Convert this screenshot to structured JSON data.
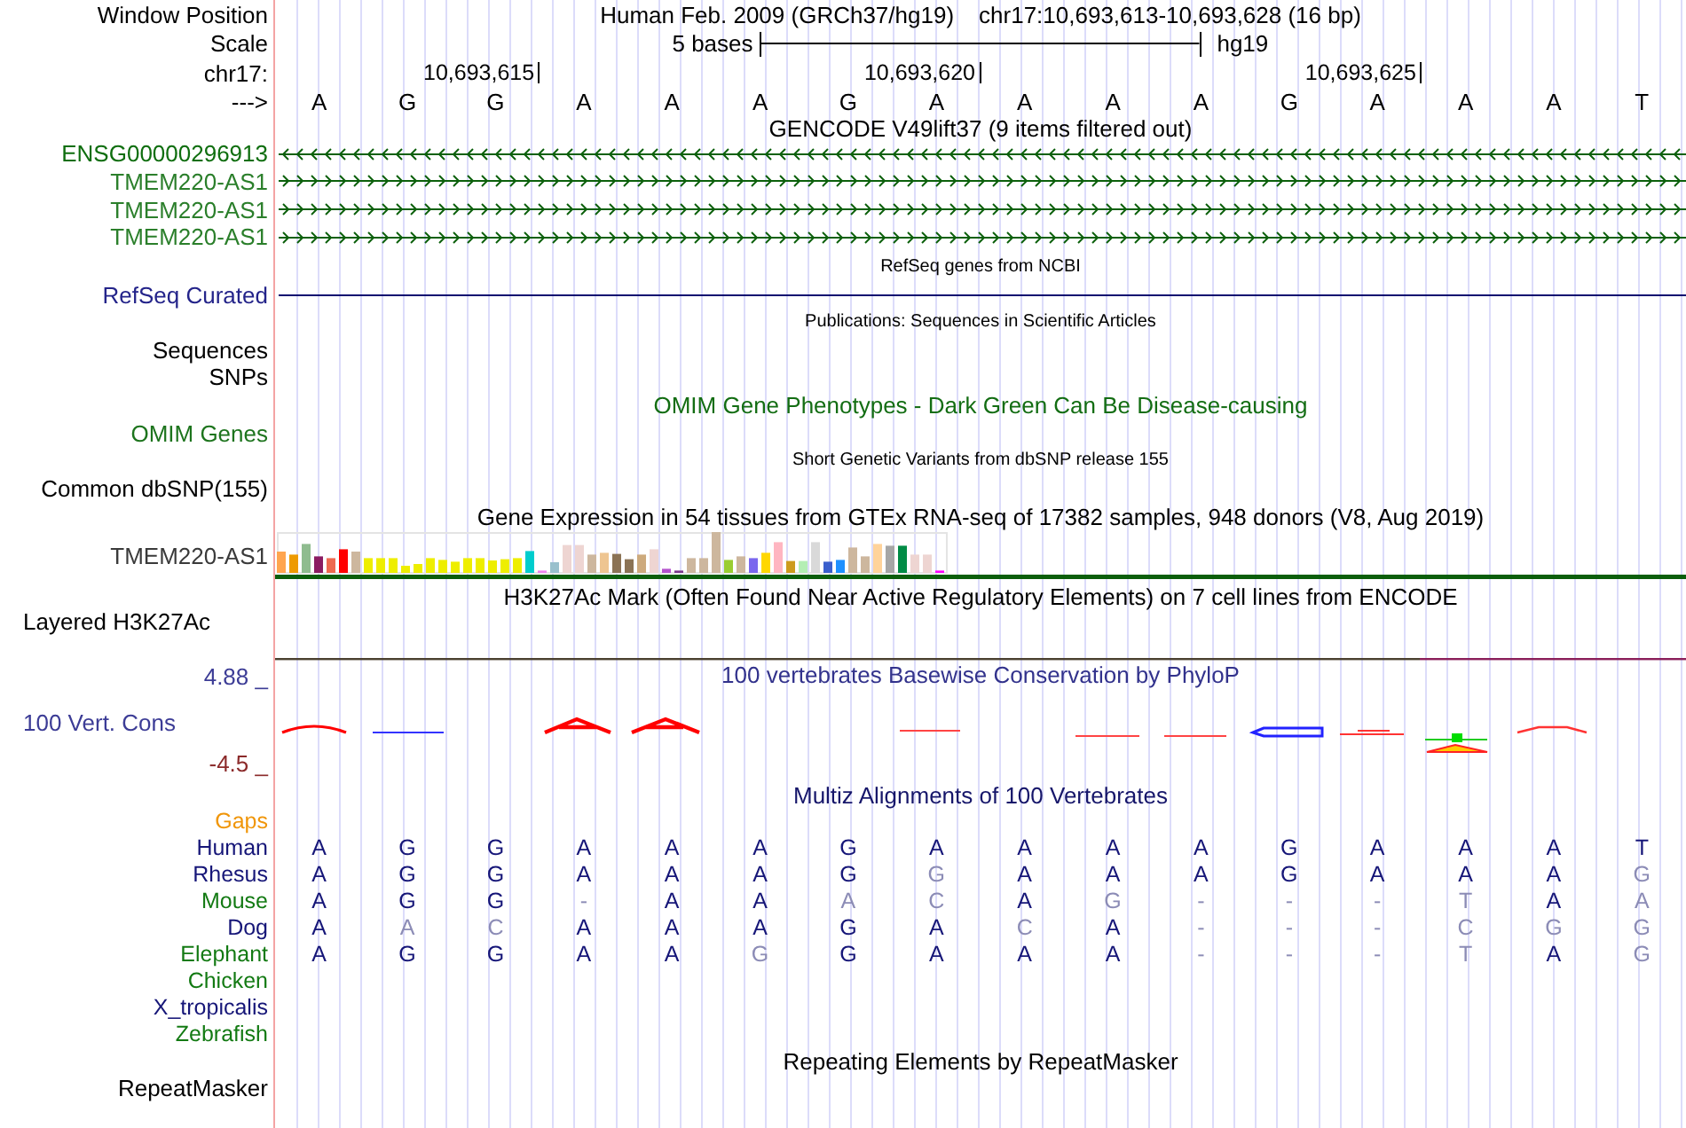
{
  "position": {
    "label": "Window Position",
    "assembly": "Human Feb. 2009 (GRCh37/hg19)",
    "range": "chr17:10,693,613-10,693,628 (16 bp)"
  },
  "scale": {
    "label": "Scale",
    "span": "5 bases",
    "assembly": "hg19"
  },
  "ruler": {
    "label": "chr17:",
    "ticks": [
      "10,693,615",
      "10,693,620",
      "10,693,625"
    ]
  },
  "sequence": {
    "label": "--->",
    "bases": [
      "A",
      "G",
      "G",
      "A",
      "A",
      "A",
      "G",
      "A",
      "A",
      "A",
      "A",
      "G",
      "A",
      "A",
      "A",
      "T"
    ]
  },
  "tracks": [
    {
      "kind": "genes",
      "title": {
        "text": "GENCODE V49lift37 (9 items filtered out)",
        "color": "#000000"
      },
      "items": [
        {
          "label": "ENSG00000296913",
          "color": "#0f6e0f",
          "minus_strand": true
        },
        {
          "label": "TMEM220-AS1",
          "color": "#2b7f2b",
          "minus_strand": false
        },
        {
          "label": "TMEM220-AS1",
          "color": "#2b7f2b",
          "minus_strand": false
        },
        {
          "label": "TMEM220-AS1",
          "color": "#2b7f2b",
          "minus_strand": false
        }
      ]
    },
    {
      "kind": "gene_line",
      "title": {
        "text": "RefSeq genes from NCBI",
        "color": "#000000"
      },
      "items": [
        {
          "label": "RefSeq Curated",
          "color": "#24248a"
        }
      ]
    },
    {
      "kind": "listing",
      "title": {
        "text": "Publications: Sequences in Scientific Articles",
        "color": "#000000"
      },
      "items": [
        {
          "label": "Sequences",
          "color": "#000000"
        },
        {
          "label": "SNPs",
          "color": "#000000"
        }
      ]
    },
    {
      "kind": "empty",
      "title": {
        "text": "OMIM Gene Phenotypes - Dark Green Can Be Disease-causing",
        "color": "#136d13"
      },
      "items": [
        {
          "label": "OMIM Genes",
          "color": "#1d741d"
        }
      ]
    },
    {
      "kind": "listing",
      "title": {
        "text": "Short Genetic Variants from dbSNP release 155",
        "color": "#000000"
      },
      "items": [
        {
          "label": "Common dbSNP(155)",
          "color": "#000000"
        }
      ]
    },
    {
      "kind": "expression",
      "title": {
        "text": "Gene Expression in 54 tissues from GTEx RNA-seq of 17382 samples, 948 donors (V8, Aug 2019)",
        "color": "#000000"
      },
      "items": [
        {
          "label": "TMEM220-AS1",
          "color": "#3a3a3a"
        }
      ]
    },
    {
      "kind": "signal",
      "title": {
        "text": "H3K27Ac Mark (Often Found Near Active Regulatory Elements) on 7 cell lines from ENCODE",
        "color": "#000000"
      },
      "items": [
        {
          "label": "Layered H3K27Ac",
          "color": "#000000"
        }
      ]
    },
    {
      "kind": "conservation",
      "title": {
        "text": "100 vertebrates Basewise Conservation by PhyloP",
        "color": "#32328c"
      },
      "items": [
        {
          "label": "4.88 _",
          "color": "#3c3c96"
        },
        {
          "label": "100 Vert. Cons",
          "color": "#3c3c96"
        },
        {
          "label": "-4.5 _",
          "color": "#8b2a2a"
        }
      ]
    },
    {
      "kind": "alignment",
      "title": {
        "text": "Multiz Alignments of 100 Vertebrates",
        "color": "#16166a"
      },
      "items": [
        {
          "label": "Gaps",
          "color": "#f0960a"
        },
        {
          "label": "Human",
          "color": "#161678",
          "bases": [
            {
              "base": "A",
              "match": true
            },
            {
              "base": "G",
              "match": true
            },
            {
              "base": "G",
              "match": true
            },
            {
              "base": "A",
              "match": true
            },
            {
              "base": "A",
              "match": true
            },
            {
              "base": "A",
              "match": true
            },
            {
              "base": "G",
              "match": true
            },
            {
              "base": "A",
              "match": true
            },
            {
              "base": "A",
              "match": true
            },
            {
              "base": "A",
              "match": true
            },
            {
              "base": "A",
              "match": true
            },
            {
              "base": "G",
              "match": true
            },
            {
              "base": "A",
              "match": true
            },
            {
              "base": "A",
              "match": true
            },
            {
              "base": "A",
              "match": true
            },
            {
              "base": "T",
              "match": true
            }
          ]
        },
        {
          "label": "Rhesus",
          "color": "#161678",
          "bases": [
            {
              "base": "A",
              "match": true
            },
            {
              "base": "G",
              "match": true
            },
            {
              "base": "G",
              "match": true
            },
            {
              "base": "A",
              "match": true
            },
            {
              "base": "A",
              "match": true
            },
            {
              "base": "A",
              "match": true
            },
            {
              "base": "G",
              "match": true
            },
            {
              "base": "G",
              "match": false
            },
            {
              "base": "A",
              "match": true
            },
            {
              "base": "A",
              "match": true
            },
            {
              "base": "A",
              "match": true
            },
            {
              "base": "G",
              "match": true
            },
            {
              "base": "A",
              "match": true
            },
            {
              "base": "A",
              "match": true
            },
            {
              "base": "A",
              "match": true
            },
            {
              "base": "G",
              "match": false
            }
          ]
        },
        {
          "label": "Mouse",
          "color": "#137a13",
          "bases": [
            {
              "base": "A",
              "match": true
            },
            {
              "base": "G",
              "match": true
            },
            {
              "base": "G",
              "match": true
            },
            {
              "base": "-",
              "match": false
            },
            {
              "base": "A",
              "match": true
            },
            {
              "base": "A",
              "match": true
            },
            {
              "base": "A",
              "match": false
            },
            {
              "base": "C",
              "match": false
            },
            {
              "base": "A",
              "match": true
            },
            {
              "base": "G",
              "match": false
            },
            {
              "base": "-",
              "match": false
            },
            {
              "base": "-",
              "match": false
            },
            {
              "base": "-",
              "match": false
            },
            {
              "base": "T",
              "match": false
            },
            {
              "base": "A",
              "match": true
            },
            {
              "base": "A",
              "match": false
            }
          ]
        },
        {
          "label": "Dog",
          "color": "#161678",
          "bases": [
            {
              "base": "A",
              "match": true
            },
            {
              "base": "A",
              "match": false
            },
            {
              "base": "C",
              "match": false
            },
            {
              "base": "A",
              "match": true
            },
            {
              "base": "A",
              "match": true
            },
            {
              "base": "A",
              "match": true
            },
            {
              "base": "G",
              "match": true
            },
            {
              "base": "A",
              "match": true
            },
            {
              "base": "C",
              "match": false
            },
            {
              "base": "A",
              "match": true
            },
            {
              "base": "-",
              "match": false
            },
            {
              "base": "-",
              "match": false
            },
            {
              "base": "-",
              "match": false
            },
            {
              "base": "C",
              "match": false
            },
            {
              "base": "G",
              "match": false
            },
            {
              "base": "G",
              "match": false
            }
          ]
        },
        {
          "label": "Elephant",
          "color": "#137a13",
          "bases": [
            {
              "base": "A",
              "match": true
            },
            {
              "base": "G",
              "match": true
            },
            {
              "base": "G",
              "match": true
            },
            {
              "base": "A",
              "match": true
            },
            {
              "base": "A",
              "match": true
            },
            {
              "base": "G",
              "match": false
            },
            {
              "base": "G",
              "match": true
            },
            {
              "base": "A",
              "match": true
            },
            {
              "base": "A",
              "match": true
            },
            {
              "base": "A",
              "match": true
            },
            {
              "base": "-",
              "match": false
            },
            {
              "base": "-",
              "match": false
            },
            {
              "base": "-",
              "match": false
            },
            {
              "base": "T",
              "match": false
            },
            {
              "base": "A",
              "match": true
            },
            {
              "base": "G",
              "match": false
            }
          ]
        },
        {
          "label": "Chicken",
          "color": "#137a13"
        },
        {
          "label": "X_tropicalis",
          "color": "#161678"
        },
        {
          "label": "Zebrafish",
          "color": "#137a13"
        }
      ]
    },
    {
      "kind": "empty",
      "title": {
        "text": "Repeating Elements by RepeatMasker",
        "color": "#000000"
      },
      "items": [
        {
          "label": "RepeatMasker",
          "color": "#000000"
        }
      ]
    }
  ]
}
